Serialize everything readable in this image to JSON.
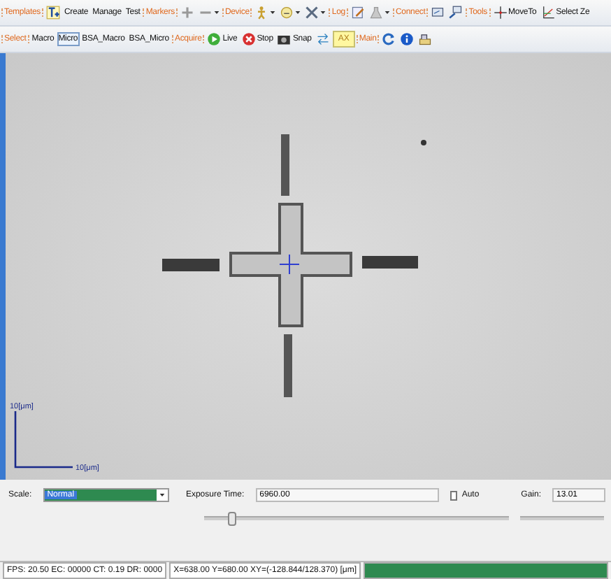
{
  "toolbar_rows": [
    [
      {
        "kind": "group",
        "label": "Templates"
      },
      {
        "kind": "icon"
      },
      {
        "kind": "button",
        "label": "Create"
      },
      {
        "kind": "button",
        "label": "Manage"
      },
      {
        "kind": "button",
        "label": "Test"
      },
      {
        "kind": "group",
        "label": "Markers"
      },
      {
        "kind": "icon"
      },
      {
        "kind": "icon"
      },
      {
        "kind": "group",
        "label": "Device"
      },
      {
        "kind": "icon"
      },
      {
        "kind": "icon"
      },
      {
        "kind": "icon"
      },
      {
        "kind": "group",
        "label": "Log"
      },
      {
        "kind": "icon"
      },
      {
        "kind": "icon"
      },
      {
        "kind": "group",
        "label": "Connect"
      },
      {
        "kind": "icon"
      },
      {
        "kind": "icon"
      },
      {
        "kind": "group",
        "label": "Tools"
      },
      {
        "kind": "button",
        "label": "MoveTo"
      },
      {
        "kind": "button",
        "label": "Select Ze"
      }
    ],
    [
      {
        "kind": "group",
        "label": "Select"
      },
      {
        "kind": "toggle",
        "label": "Macro",
        "selected": false
      },
      {
        "kind": "toggle",
        "label": "Micro",
        "selected": true
      },
      {
        "kind": "toggle",
        "label": "BSA_Macro",
        "selected": false
      },
      {
        "kind": "toggle",
        "label": "BSA_Micro",
        "selected": false
      },
      {
        "kind": "group",
        "label": "Acquire"
      },
      {
        "kind": "button",
        "label": "Live"
      },
      {
        "kind": "button",
        "label": "Stop"
      },
      {
        "kind": "button",
        "label": "Snap"
      },
      {
        "kind": "icon"
      },
      {
        "kind": "tag",
        "label": "AX"
      },
      {
        "kind": "group",
        "label": "Main"
      },
      {
        "kind": "icon"
      },
      {
        "kind": "icon"
      },
      {
        "kind": "icon"
      }
    ]
  ],
  "image": {
    "scale_y_label": "10[μm]",
    "scale_x_label": "10[μm]"
  },
  "controls": {
    "scale": {
      "label": "Scale:",
      "value": "Normal"
    },
    "exposure": {
      "label": "Exposure Time:",
      "value": "6960.00",
      "level": 0.08
    },
    "auto": {
      "label": "Auto",
      "checked": false
    },
    "gain": {
      "label": "Gain:",
      "value": "13.01"
    }
  },
  "status_bar": {
    "fields": [
      "FPS: 20.50 EC: 00000 CT: 0.19 DR: 0000",
      "X=638.00 Y=680.00 XY=(-128.844/128.370) [μm]"
    ],
    "level": 1
  }
}
